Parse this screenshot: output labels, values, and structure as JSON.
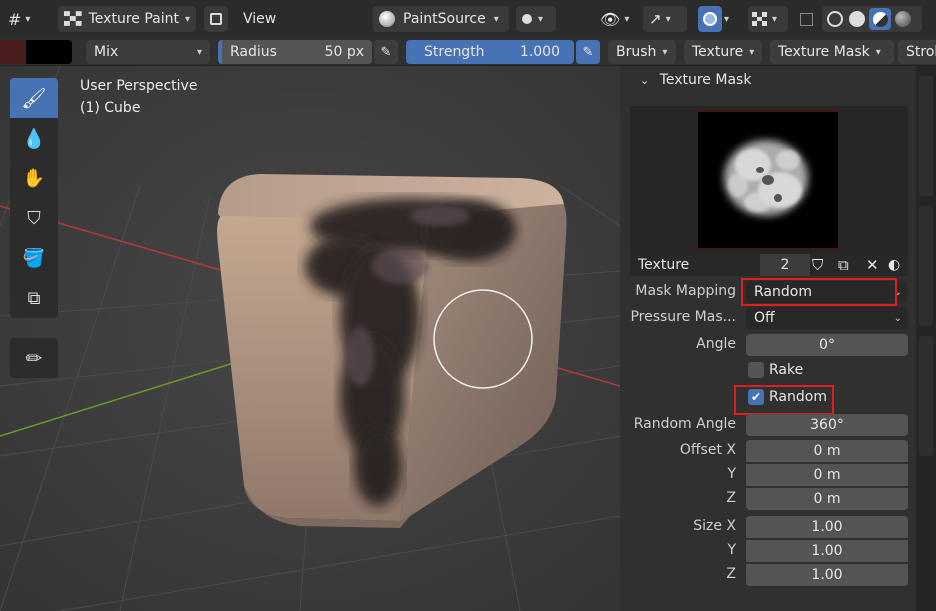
{
  "header": {
    "mode_label": "Texture Paint",
    "view_label": "View",
    "paint_source": "PaintSource"
  },
  "tool_settings": {
    "blend_mode": "Mix",
    "radius_label": "Radius",
    "radius_value": "50 px",
    "strength_label": "Strength",
    "strength_value": "1.000",
    "brush_menu": "Brush",
    "texture_menu": "Texture",
    "texture_mask_menu": "Texture Mask",
    "stroke_menu": "Strok",
    "primary_color": "#000000",
    "secondary_color": "#4a1e1e"
  },
  "viewport": {
    "line1": "User Perspective",
    "line2": "(1) Cube"
  },
  "panel": {
    "title": "Texture Mask",
    "texture_label": "Texture",
    "texture_users": "2",
    "mask_mapping_label": "Mask Mapping",
    "mask_mapping_value": "Random",
    "pressure_label": "Pressure Mas...",
    "pressure_value": "Off",
    "angle_label": "Angle",
    "angle_value": "0°",
    "rake_label": "Rake",
    "random_label": "Random",
    "random_angle_label": "Random Angle",
    "random_angle_value": "360°",
    "offset_x_label": "Offset X",
    "offset_x": "0 m",
    "offset_y_label": "Y",
    "offset_y": "0 m",
    "offset_z_label": "Z",
    "offset_z": "0 m",
    "size_x_label": "Size X",
    "size_x": "1.00",
    "size_y_label": "Y",
    "size_y": "1.00",
    "size_z_label": "Z",
    "size_z": "1.00"
  },
  "colors": {
    "accent": "#4772b3",
    "highlight": "#e01e1e"
  }
}
